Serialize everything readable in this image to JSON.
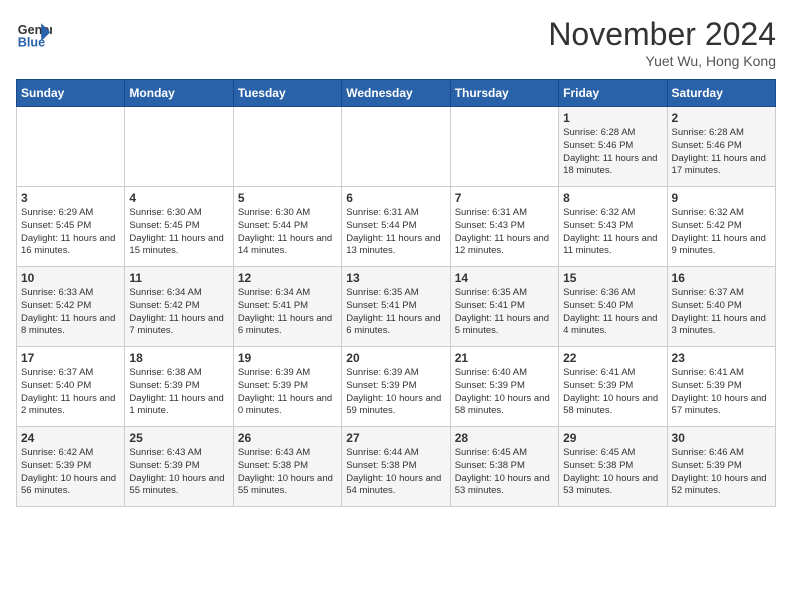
{
  "header": {
    "logo_line1": "General",
    "logo_line2": "Blue",
    "month_title": "November 2024",
    "subtitle": "Yuet Wu, Hong Kong"
  },
  "weekdays": [
    "Sunday",
    "Monday",
    "Tuesday",
    "Wednesday",
    "Thursday",
    "Friday",
    "Saturday"
  ],
  "weeks": [
    [
      {
        "day": "",
        "info": ""
      },
      {
        "day": "",
        "info": ""
      },
      {
        "day": "",
        "info": ""
      },
      {
        "day": "",
        "info": ""
      },
      {
        "day": "",
        "info": ""
      },
      {
        "day": "1",
        "info": "Sunrise: 6:28 AM\nSunset: 5:46 PM\nDaylight: 11 hours and 18 minutes."
      },
      {
        "day": "2",
        "info": "Sunrise: 6:28 AM\nSunset: 5:46 PM\nDaylight: 11 hours and 17 minutes."
      }
    ],
    [
      {
        "day": "3",
        "info": "Sunrise: 6:29 AM\nSunset: 5:45 PM\nDaylight: 11 hours and 16 minutes."
      },
      {
        "day": "4",
        "info": "Sunrise: 6:30 AM\nSunset: 5:45 PM\nDaylight: 11 hours and 15 minutes."
      },
      {
        "day": "5",
        "info": "Sunrise: 6:30 AM\nSunset: 5:44 PM\nDaylight: 11 hours and 14 minutes."
      },
      {
        "day": "6",
        "info": "Sunrise: 6:31 AM\nSunset: 5:44 PM\nDaylight: 11 hours and 13 minutes."
      },
      {
        "day": "7",
        "info": "Sunrise: 6:31 AM\nSunset: 5:43 PM\nDaylight: 11 hours and 12 minutes."
      },
      {
        "day": "8",
        "info": "Sunrise: 6:32 AM\nSunset: 5:43 PM\nDaylight: 11 hours and 11 minutes."
      },
      {
        "day": "9",
        "info": "Sunrise: 6:32 AM\nSunset: 5:42 PM\nDaylight: 11 hours and 9 minutes."
      }
    ],
    [
      {
        "day": "10",
        "info": "Sunrise: 6:33 AM\nSunset: 5:42 PM\nDaylight: 11 hours and 8 minutes."
      },
      {
        "day": "11",
        "info": "Sunrise: 6:34 AM\nSunset: 5:42 PM\nDaylight: 11 hours and 7 minutes."
      },
      {
        "day": "12",
        "info": "Sunrise: 6:34 AM\nSunset: 5:41 PM\nDaylight: 11 hours and 6 minutes."
      },
      {
        "day": "13",
        "info": "Sunrise: 6:35 AM\nSunset: 5:41 PM\nDaylight: 11 hours and 6 minutes."
      },
      {
        "day": "14",
        "info": "Sunrise: 6:35 AM\nSunset: 5:41 PM\nDaylight: 11 hours and 5 minutes."
      },
      {
        "day": "15",
        "info": "Sunrise: 6:36 AM\nSunset: 5:40 PM\nDaylight: 11 hours and 4 minutes."
      },
      {
        "day": "16",
        "info": "Sunrise: 6:37 AM\nSunset: 5:40 PM\nDaylight: 11 hours and 3 minutes."
      }
    ],
    [
      {
        "day": "17",
        "info": "Sunrise: 6:37 AM\nSunset: 5:40 PM\nDaylight: 11 hours and 2 minutes."
      },
      {
        "day": "18",
        "info": "Sunrise: 6:38 AM\nSunset: 5:39 PM\nDaylight: 11 hours and 1 minute."
      },
      {
        "day": "19",
        "info": "Sunrise: 6:39 AM\nSunset: 5:39 PM\nDaylight: 11 hours and 0 minutes."
      },
      {
        "day": "20",
        "info": "Sunrise: 6:39 AM\nSunset: 5:39 PM\nDaylight: 10 hours and 59 minutes."
      },
      {
        "day": "21",
        "info": "Sunrise: 6:40 AM\nSunset: 5:39 PM\nDaylight: 10 hours and 58 minutes."
      },
      {
        "day": "22",
        "info": "Sunrise: 6:41 AM\nSunset: 5:39 PM\nDaylight: 10 hours and 58 minutes."
      },
      {
        "day": "23",
        "info": "Sunrise: 6:41 AM\nSunset: 5:39 PM\nDaylight: 10 hours and 57 minutes."
      }
    ],
    [
      {
        "day": "24",
        "info": "Sunrise: 6:42 AM\nSunset: 5:39 PM\nDaylight: 10 hours and 56 minutes."
      },
      {
        "day": "25",
        "info": "Sunrise: 6:43 AM\nSunset: 5:39 PM\nDaylight: 10 hours and 55 minutes."
      },
      {
        "day": "26",
        "info": "Sunrise: 6:43 AM\nSunset: 5:38 PM\nDaylight: 10 hours and 55 minutes."
      },
      {
        "day": "27",
        "info": "Sunrise: 6:44 AM\nSunset: 5:38 PM\nDaylight: 10 hours and 54 minutes."
      },
      {
        "day": "28",
        "info": "Sunrise: 6:45 AM\nSunset: 5:38 PM\nDaylight: 10 hours and 53 minutes."
      },
      {
        "day": "29",
        "info": "Sunrise: 6:45 AM\nSunset: 5:38 PM\nDaylight: 10 hours and 53 minutes."
      },
      {
        "day": "30",
        "info": "Sunrise: 6:46 AM\nSunset: 5:39 PM\nDaylight: 10 hours and 52 minutes."
      }
    ]
  ]
}
